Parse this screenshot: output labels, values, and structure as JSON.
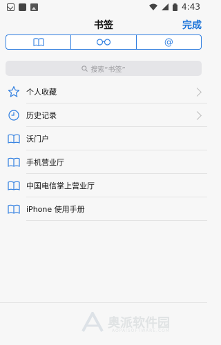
{
  "status_bar": {
    "time": "4:43"
  },
  "nav": {
    "title": "书签",
    "done_label": "完成"
  },
  "segments": [
    {
      "icon": "book-icon"
    },
    {
      "icon": "glasses-icon"
    },
    {
      "icon": "at-icon",
      "label": "@"
    }
  ],
  "search": {
    "placeholder": "搜索“书签”"
  },
  "bookmarks": [
    {
      "label": "个人收藏",
      "icon": "star-icon",
      "chevron": true
    },
    {
      "label": "历史记录",
      "icon": "clock-icon",
      "chevron": true
    },
    {
      "label": "沃门户",
      "icon": "book-icon",
      "chevron": false
    },
    {
      "label": "手机营业厅",
      "icon": "book-icon",
      "chevron": false
    },
    {
      "label": "中国电信掌上营业厅",
      "icon": "book-icon",
      "chevron": false
    },
    {
      "label": "iPhone 使用手册",
      "icon": "book-icon",
      "chevron": false
    }
  ],
  "watermark": {
    "text": "奥派软件园",
    "sub": "AOPAISOFTWARE.COM"
  },
  "colors": {
    "accent": "#2f7ee0",
    "done": "#1a73d9"
  }
}
